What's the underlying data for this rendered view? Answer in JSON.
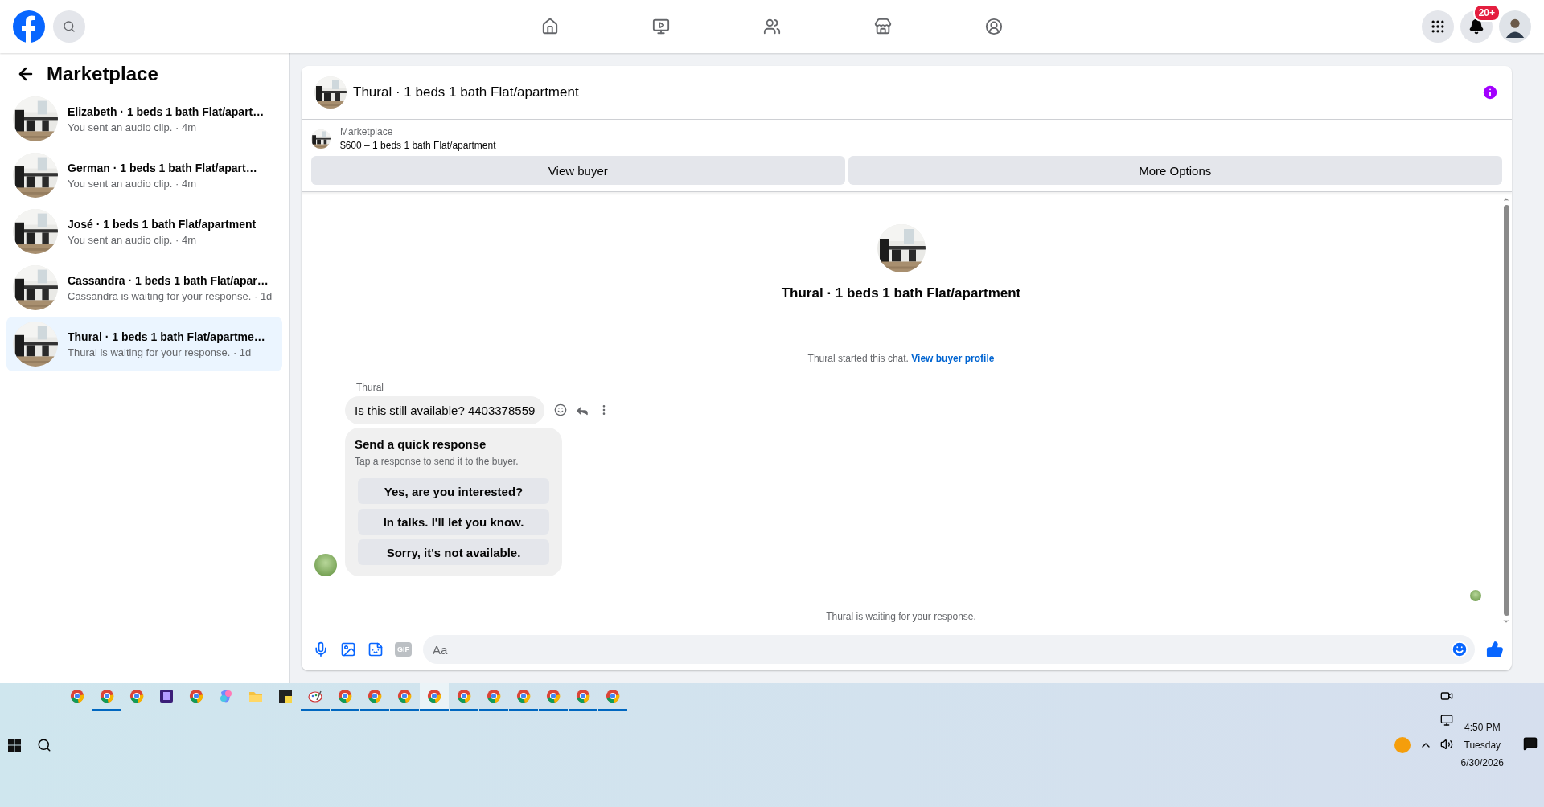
{
  "topbar": {
    "notification_count": "20+"
  },
  "sidebar": {
    "title": "Marketplace",
    "conversations": [
      {
        "title": "Elizabeth · 1 beds 1 bath Flat/apart…",
        "subtitle": "You sent an audio clip. · 4m",
        "selected": false
      },
      {
        "title": "German · 1 beds 1 bath Flat/apart…",
        "subtitle": "You sent an audio clip. · 4m",
        "selected": false
      },
      {
        "title": "José · 1 beds 1 bath Flat/apartment",
        "subtitle": "You sent an audio clip. · 4m",
        "selected": false
      },
      {
        "title": "Cassandra · 1 beds 1 bath Flat/apar…",
        "subtitle": "Cassandra is waiting for your response. · 1d",
        "selected": false
      },
      {
        "title": "Thural · 1 beds 1 bath Flat/apartme…",
        "subtitle": "Thural is waiting for your response. · 1d",
        "selected": true
      }
    ]
  },
  "chat": {
    "title": "Thural · 1 beds 1 bath Flat/apartment",
    "listing": {
      "label": "Marketplace",
      "name": "$600 – 1 beds 1 bath Flat/apartment"
    },
    "buttons": [
      "View buyer",
      "More Options"
    ],
    "intro_title": "Thural · 1 beds 1 bath Flat/apartment",
    "started_text": "Thural started this chat.",
    "started_link": "View buyer profile",
    "sender": "Thural",
    "message": "Is this still available? 4403378559",
    "quick_response": {
      "title": "Send a quick response",
      "hint": "Tap a response to send it to the buyer.",
      "options": [
        "Yes, are you interested?",
        "In talks. I'll let you know.",
        "Sorry, it's not available."
      ]
    },
    "status": "Thural is waiting for your response.",
    "composer": {
      "gif_label": "GIF",
      "placeholder": "Aa"
    }
  },
  "taskbar": {
    "apps": [
      {
        "kind": "browser",
        "open": false,
        "selected": false
      },
      {
        "kind": "browser",
        "open": true,
        "selected": false
      },
      {
        "kind": "browser",
        "open": false,
        "selected": false
      },
      {
        "kind": "app",
        "open": false,
        "selected": false
      },
      {
        "kind": "browser",
        "open": false,
        "selected": false
      },
      {
        "kind": "assistant",
        "open": false,
        "selected": false
      },
      {
        "kind": "folder",
        "open": false,
        "selected": false
      },
      {
        "kind": "note",
        "open": false,
        "selected": false
      },
      {
        "kind": "paint",
        "open": true,
        "selected": false
      },
      {
        "kind": "browser",
        "open": true,
        "selected": false
      },
      {
        "kind": "browser",
        "open": true,
        "selected": false
      },
      {
        "kind": "browser",
        "open": true,
        "selected": false
      },
      {
        "kind": "browser",
        "open": true,
        "selected": true
      },
      {
        "kind": "browser",
        "open": true,
        "selected": false
      },
      {
        "kind": "browser",
        "open": true,
        "selected": false
      },
      {
        "kind": "browser",
        "open": true,
        "selected": false
      },
      {
        "kind": "browser",
        "open": true,
        "selected": false
      },
      {
        "kind": "browser",
        "open": true,
        "selected": false
      },
      {
        "kind": "browser",
        "open": true,
        "selected": false
      }
    ],
    "clock": {
      "time": "4:50 PM",
      "day": "Tuesday",
      "date": "6/30/2026"
    }
  }
}
